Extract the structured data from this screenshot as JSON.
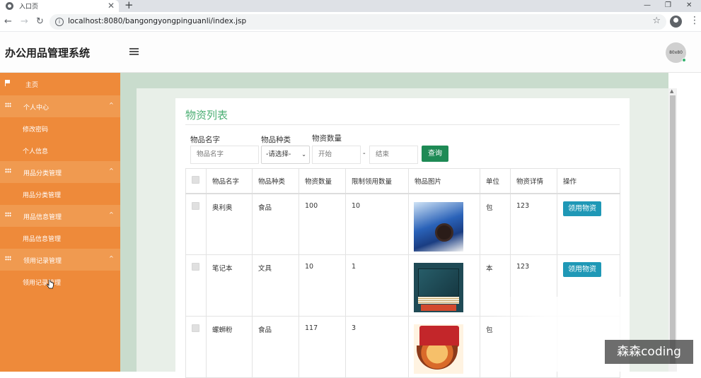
{
  "browser": {
    "tab_title": "入口页",
    "tab_close": "✕",
    "new_tab": "+",
    "url": "localhost:8080/bangongyongpinguanli/index.jsp",
    "window_controls": [
      "—",
      "❐",
      "✕"
    ]
  },
  "app": {
    "title": "办公用品管理系统",
    "avatar_text": "80x80"
  },
  "sidebar": {
    "items": [
      {
        "label": "主页",
        "icon": "flag-icon",
        "type": "top"
      },
      {
        "label": "个人中心",
        "icon": "grid-icon",
        "type": "group",
        "caret": "^"
      },
      {
        "label": "修改密码",
        "type": "sub"
      },
      {
        "label": "个人信息",
        "type": "sub"
      },
      {
        "label": "用品分类管理",
        "icon": "grid-icon",
        "type": "group",
        "caret": "^"
      },
      {
        "label": "用品分类管理",
        "type": "sub"
      },
      {
        "label": "用品信息管理",
        "icon": "grid-icon",
        "type": "group",
        "caret": "^"
      },
      {
        "label": "用品信息管理",
        "type": "sub"
      },
      {
        "label": "领用记录管理",
        "icon": "grid-icon",
        "type": "group",
        "caret": "^"
      },
      {
        "label": "领用记录管理",
        "type": "sub"
      }
    ]
  },
  "panel": {
    "title": "物资列表",
    "filters": {
      "name_label": "物品名字",
      "name_placeholder": "物品名字",
      "type_label": "物品种类",
      "type_selected": "-请选择-",
      "qty_label": "物资数量",
      "qty_start_placeholder": "开始",
      "qty_separator": "-",
      "qty_end_placeholder": "结束",
      "search_button": "查询"
    },
    "table": {
      "columns": [
        "物品名字",
        "物品种类",
        "物资数量",
        "限制领用数量",
        "物品图片",
        "单位",
        "物资详情",
        "操作"
      ],
      "rows": [
        {
          "name": "奥利奥",
          "type": "食品",
          "qty": "100",
          "limit": "10",
          "image": "oreo",
          "unit": "包",
          "detail": "123",
          "action": "领用物资"
        },
        {
          "name": "笔记本",
          "type": "文具",
          "qty": "10",
          "limit": "1",
          "image": "notebook",
          "unit": "本",
          "detail": "123",
          "action": "领用物资"
        },
        {
          "name": "螺蛳粉",
          "type": "食品",
          "qty": "117",
          "limit": "3",
          "image": "noodle",
          "unit": "包",
          "detail": "",
          "action": ""
        }
      ]
    }
  },
  "watermark": "森森coding"
}
